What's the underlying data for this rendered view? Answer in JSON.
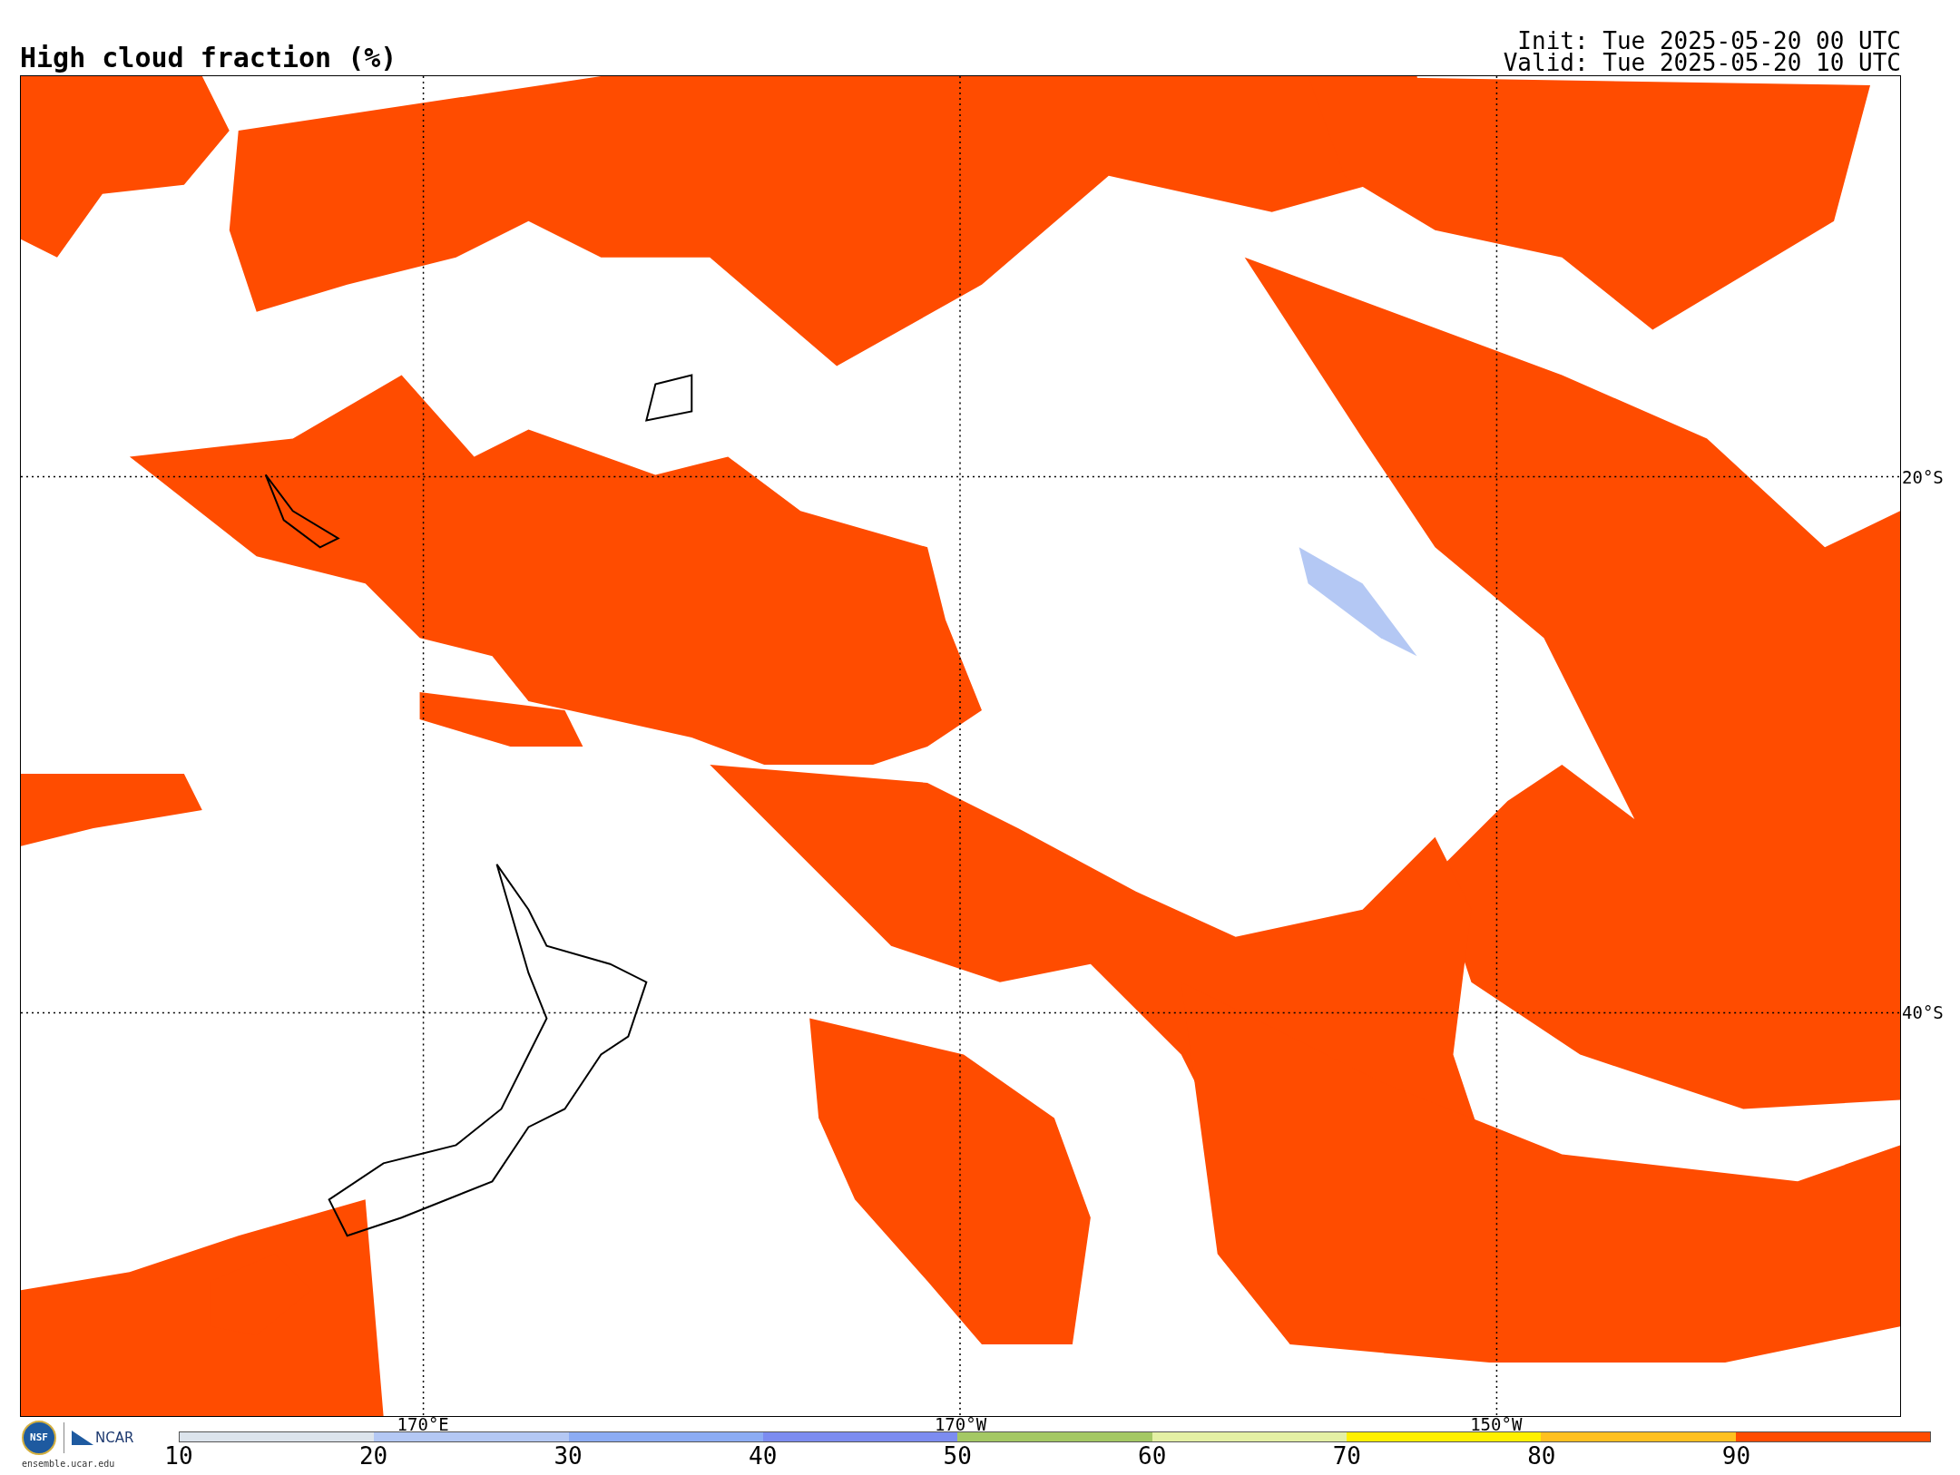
{
  "title": "High cloud fraction (%)",
  "init": "Init: Tue 2025-05-20 00 UTC",
  "valid": "Valid: Tue 2025-05-20 10 UTC",
  "map": {
    "lat_labels": [
      "20°S",
      "40°S"
    ],
    "lon_labels": [
      "170°E",
      "170°W",
      "150°W"
    ]
  },
  "logos": {
    "nsf": "NSF",
    "ncar": "NCAR",
    "site": "ensemble.ucar.edu"
  },
  "colorbar": {
    "segments": [
      {
        "color": "#dce4ec"
      },
      {
        "color": "#b4c8f4"
      },
      {
        "color": "#8cacf4"
      },
      {
        "color": "#7c8cf0"
      },
      {
        "color": "#a4c864"
      },
      {
        "color": "#e4f0a4"
      },
      {
        "color": "#fff000"
      },
      {
        "color": "#ffc020"
      },
      {
        "color": "#ff4c00"
      }
    ],
    "ticks": [
      "10",
      "20",
      "30",
      "40",
      "50",
      "60",
      "70",
      "80",
      "90"
    ]
  }
}
